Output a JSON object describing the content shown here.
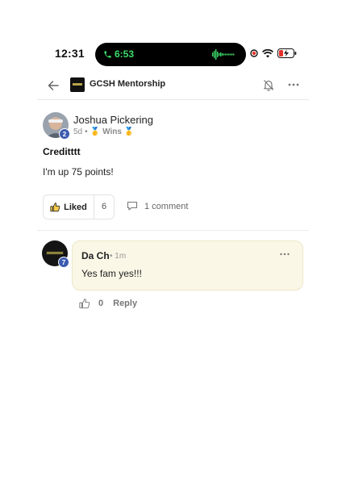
{
  "status_bar": {
    "time": "12:31",
    "call_time": "6:53"
  },
  "header": {
    "group_name": "GCSH Mentorship"
  },
  "post": {
    "author": "Joshua Pickering",
    "level": "2",
    "age": "5d",
    "meta_separator": "•",
    "category_emoji": "🥇",
    "category": "Wins",
    "title": "Creditttt",
    "body": "I'm up 75 points!",
    "like_label": "Liked",
    "like_count": "6",
    "comment_label": "1 comment"
  },
  "comment": {
    "author": "Da Ch",
    "level": "7",
    "time": "• 1m",
    "text": "Yes fam yes!!!",
    "like_count": "0",
    "reply_label": "Reply"
  },
  "colors": {
    "call_green": "#3ddc6a",
    "badge_blue": "#3c5bb0",
    "comment_bg": "#faf7e6"
  }
}
